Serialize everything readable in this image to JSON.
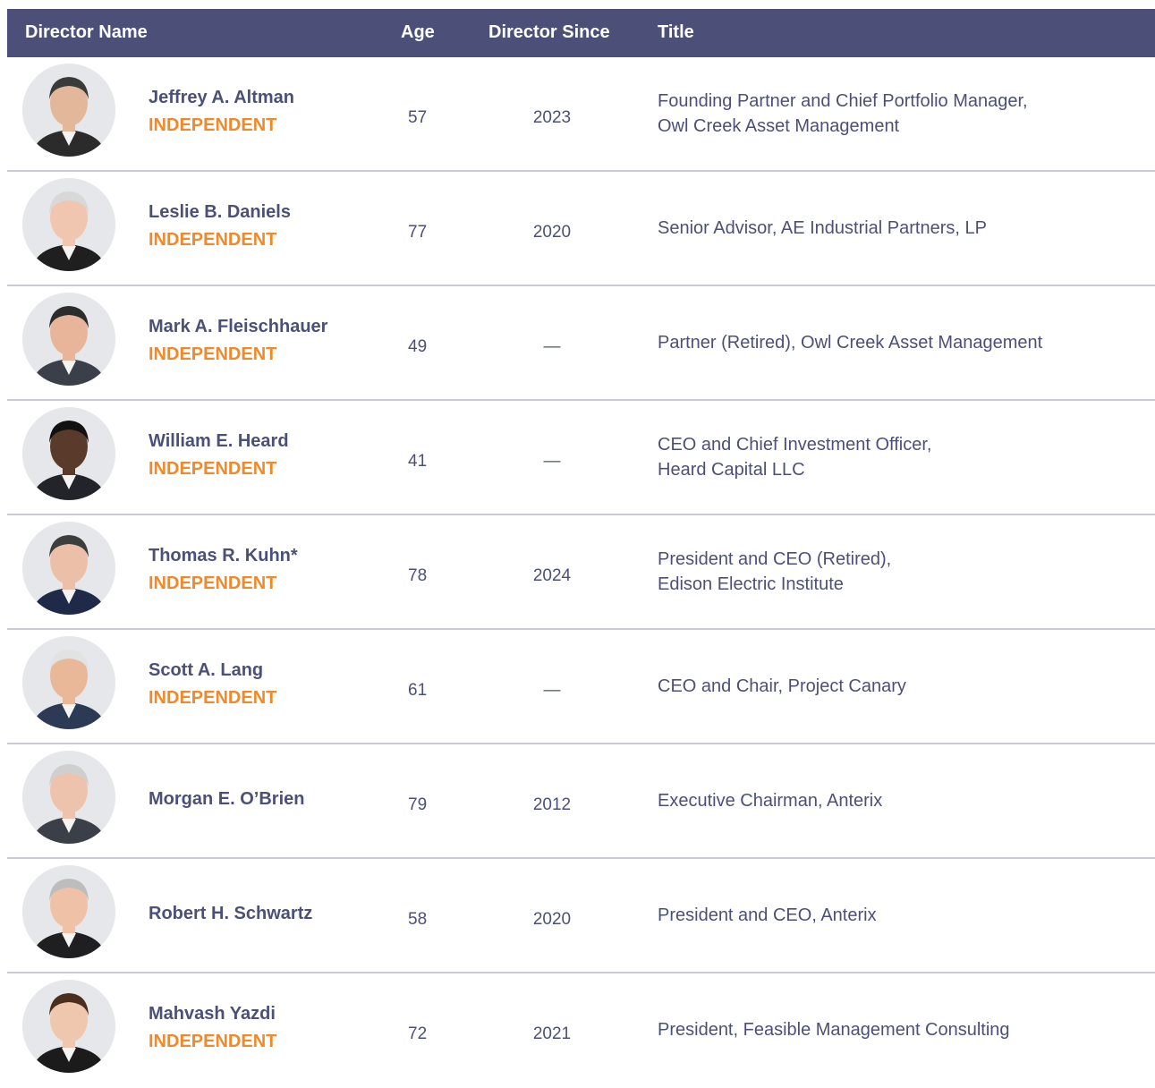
{
  "header": {
    "name": "Director Name",
    "age": "Age",
    "since": "Director Since",
    "title": "Title"
  },
  "colors": {
    "header_bg": "#4c5078",
    "text": "#4c5078",
    "independent": "#f0892c",
    "divider": "#c9cad6"
  },
  "directors": [
    {
      "name": "Jeffrey A. Altman",
      "status": "INDEPENDENT",
      "age": "57",
      "since": "2023",
      "title": [
        "Founding Partner and Chief Portfolio Manager,",
        "Owl Creek Asset Management"
      ],
      "photo": "director-headshot"
    },
    {
      "name": "Leslie B. Daniels",
      "status": "INDEPENDENT",
      "age": "77",
      "since": "2020",
      "title": [
        "Senior Advisor, AE Industrial Partners, LP"
      ],
      "photo": "director-headshot"
    },
    {
      "name": "Mark A. Fleischhauer",
      "status": "INDEPENDENT",
      "age": "49",
      "since": "—",
      "title": [
        "Partner (Retired), Owl Creek Asset Management"
      ],
      "photo": "director-headshot"
    },
    {
      "name": "William E. Heard",
      "status": "INDEPENDENT",
      "age": "41",
      "since": "—",
      "title": [
        "CEO and Chief Investment Officer,",
        "Heard Capital LLC"
      ],
      "photo": "director-headshot"
    },
    {
      "name": "Thomas R. Kuhn*",
      "status": "INDEPENDENT",
      "age": "78",
      "since": "2024",
      "title": [
        "President and CEO (Retired),",
        "Edison Electric Institute"
      ],
      "photo": "director-headshot"
    },
    {
      "name": "Scott A. Lang",
      "status": "INDEPENDENT",
      "age": "61",
      "since": "—",
      "title": [
        "CEO and Chair, Project Canary"
      ],
      "photo": "director-headshot"
    },
    {
      "name": "Morgan E. O’Brien",
      "status": "",
      "age": "79",
      "since": "2012",
      "title": [
        "Executive Chairman, Anterix"
      ],
      "photo": "director-headshot"
    },
    {
      "name": "Robert H. Schwartz",
      "status": "",
      "age": "58",
      "since": "2020",
      "title": [
        "President and CEO, Anterix"
      ],
      "photo": "director-headshot"
    },
    {
      "name": "Mahvash Yazdi",
      "status": "INDEPENDENT",
      "age": "72",
      "since": "2021",
      "title": [
        "President, Feasible Management Consulting"
      ],
      "photo": "director-headshot"
    }
  ]
}
